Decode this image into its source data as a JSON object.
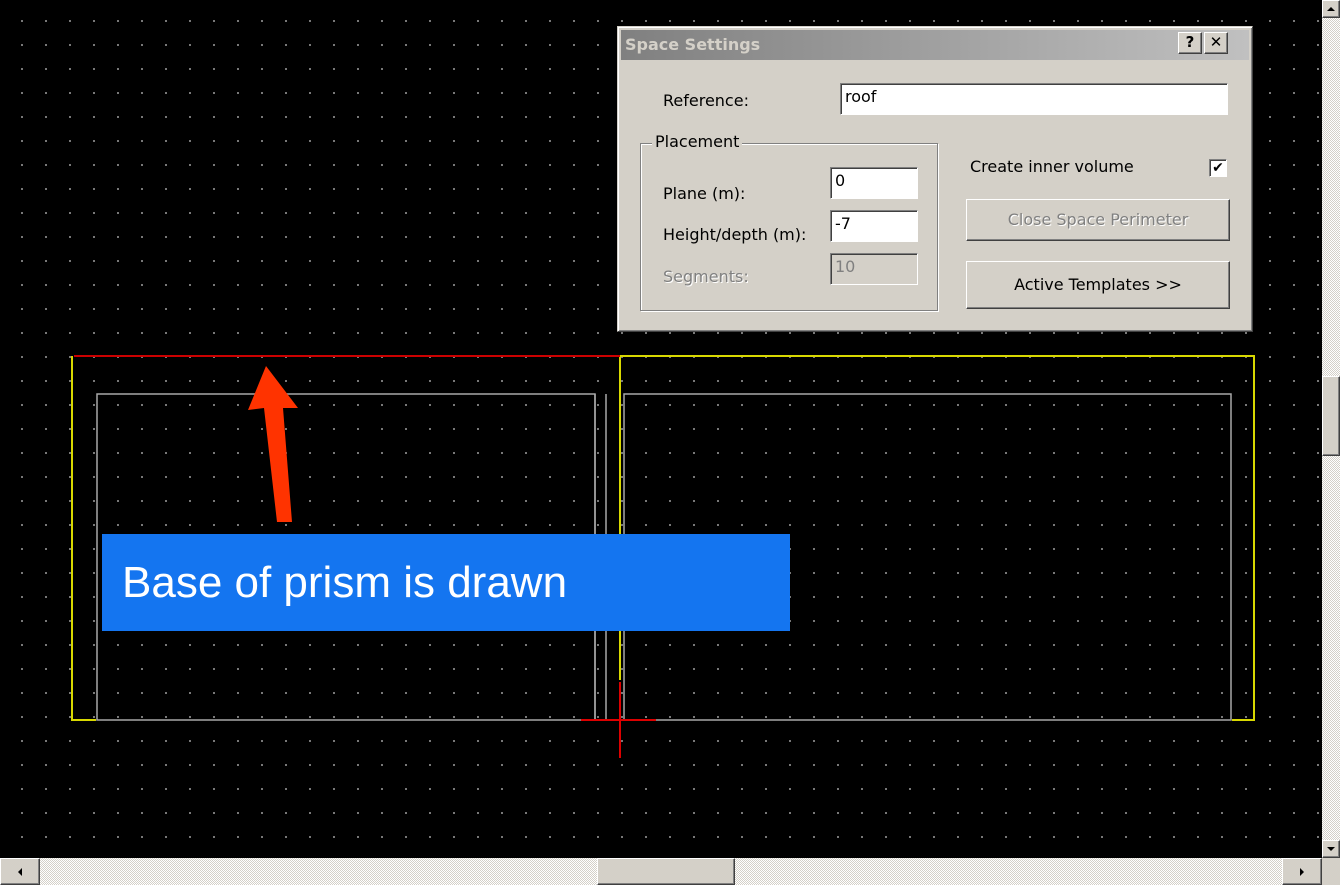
{
  "dialog": {
    "title": "Space Settings",
    "help_button": "?",
    "close_button": "✕",
    "reference_label": "Reference:",
    "reference_value": "roof",
    "placement_group": "Placement",
    "plane_label": "Plane (m):",
    "plane_value": "0",
    "height_label": "Height/depth (m):",
    "height_value": "-7",
    "segments_label": "Segments:",
    "segments_value": "10",
    "inner_volume_label": "Create inner volume",
    "inner_volume_checked": true,
    "inner_volume_mark": "✔",
    "close_perimeter_button": "Close Space Perimeter",
    "active_templates_button": "Active Templates >>"
  },
  "annotation": {
    "text": "Base of prism is drawn",
    "background": "#1475f0"
  },
  "drawing": {
    "colors": {
      "base_edge": "#cc0000",
      "outline": "#d8d800",
      "wall": "#a8a8a8",
      "cursor": "#dd0000",
      "arrow": "#ff3300",
      "grid_dot": "#8a8a8a"
    }
  }
}
